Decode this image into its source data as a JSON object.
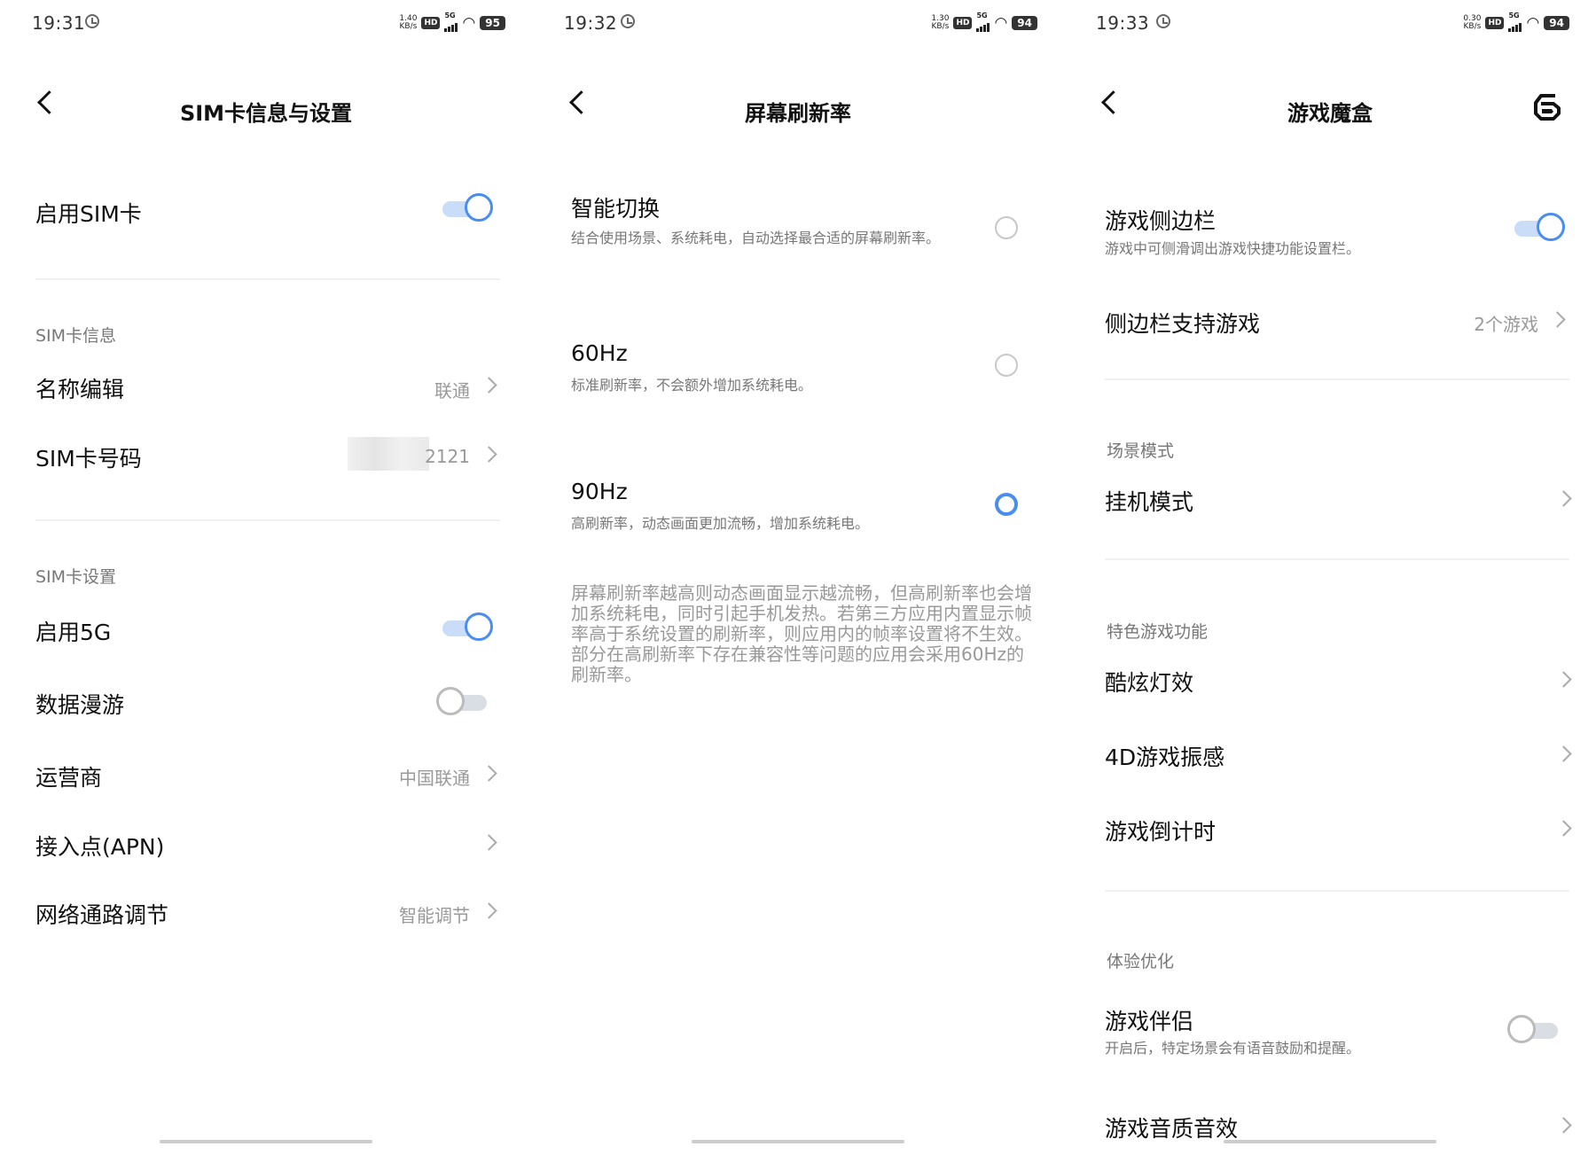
{
  "screens": [
    {
      "status": {
        "time": "19:31",
        "speed": "1.40",
        "speed_unit": "KB/s",
        "hd": "HD",
        "net": "5G",
        "battery": "95"
      },
      "title": "SIM卡信息与设置",
      "enable_sim": {
        "label": "启用SIM卡",
        "on": true
      },
      "sim_info": {
        "section": "SIM卡信息",
        "name_edit": {
          "label": "名称编辑",
          "value": "联通"
        },
        "sim_number": {
          "label": "SIM卡号码",
          "value": "2121"
        }
      },
      "sim_settings": {
        "section": "SIM卡设置",
        "enable_5g": {
          "label": "启用5G",
          "on": true
        },
        "roaming": {
          "label": "数据漫游",
          "on": false
        },
        "carrier": {
          "label": "运营商",
          "value": "中国联通"
        },
        "apn": {
          "label": "接入点(APN)"
        },
        "network": {
          "label": "网络通路调节",
          "value": "智能调节"
        }
      }
    },
    {
      "status": {
        "time": "19:32",
        "speed": "1.30",
        "speed_unit": "KB/s",
        "hd": "HD",
        "net": "5G",
        "battery": "94"
      },
      "title": "屏幕刷新率",
      "options": [
        {
          "label": "智能切换",
          "desc": "结合使用场景、系统耗电，自动选择最合适的屏幕刷新率。",
          "selected": false
        },
        {
          "label": "60Hz",
          "desc": "标准刷新率，不会额外增加系统耗电。",
          "selected": false
        },
        {
          "label": "90Hz",
          "desc": "高刷新率，动态画面更加流畅，增加系统耗电。",
          "selected": true
        }
      ],
      "note": "屏幕刷新率越高则动态画面显示越流畅，但高刷新率也会增加系统耗电，同时引起手机发热。若第三方应用内置显示帧率高于系统设置的刷新率，则应用内的帧率设置将不生效。部分在高刷新率下存在兼容性等问题的应用会采用60Hz的刷新率。"
    },
    {
      "status": {
        "time": "19:33",
        "speed": "0.30",
        "speed_unit": "KB/s",
        "hd": "HD",
        "net": "5G",
        "battery": "94"
      },
      "title": "游戏魔盒",
      "sidebar": {
        "label": "游戏侧边栏",
        "desc": "游戏中可侧滑调出游戏快捷功能设置栏。",
        "on": true
      },
      "sidebar_games": {
        "label": "侧边栏支持游戏",
        "value": "2个游戏"
      },
      "scene": {
        "section": "场景模式",
        "afk": {
          "label": "挂机模式"
        }
      },
      "features": {
        "section": "特色游戏功能",
        "lights": {
          "label": "酷炫灯效"
        },
        "vibration": {
          "label": "4D游戏振感"
        },
        "countdown": {
          "label": "游戏倒计时"
        }
      },
      "experience": {
        "section": "体验优化",
        "companion": {
          "label": "游戏伴侣",
          "desc": "开启后，特定场景会有语音鼓励和提醒。",
          "on": false
        },
        "audio": {
          "label": "游戏音质音效"
        }
      }
    }
  ]
}
